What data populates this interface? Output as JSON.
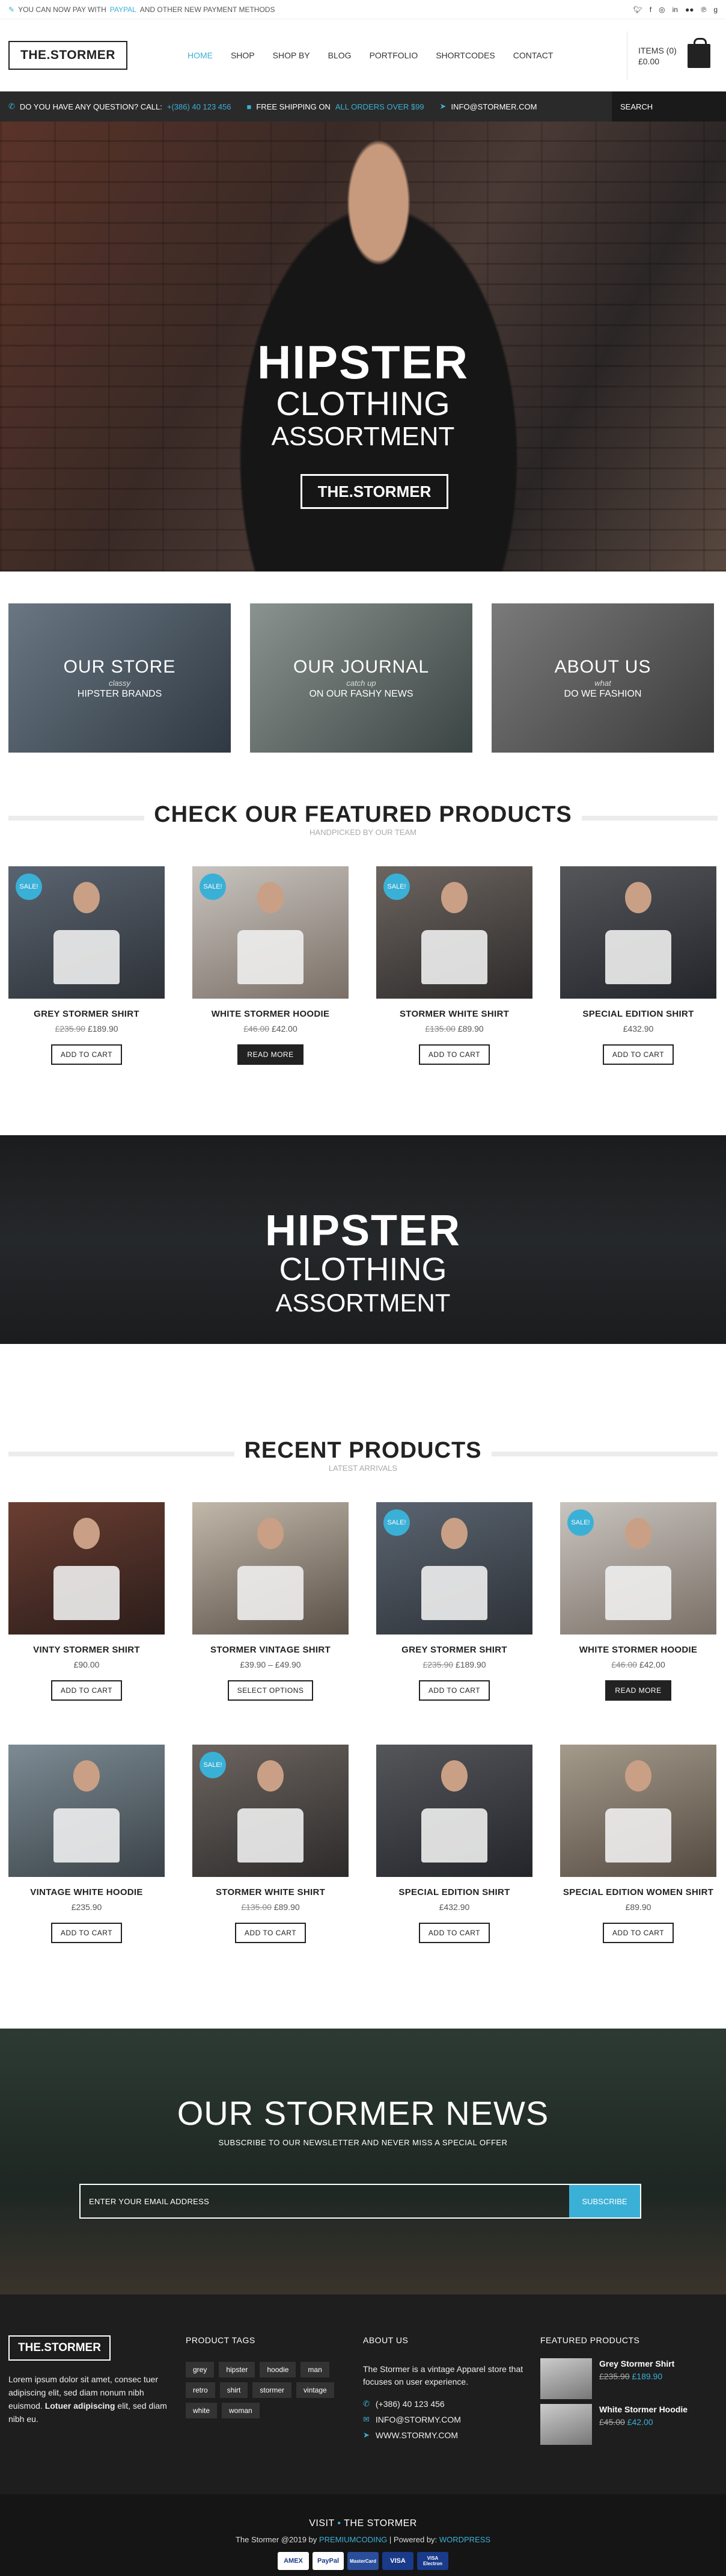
{
  "topbar": {
    "msg_prefix": "YOU CAN NOW PAY WITH",
    "msg_accent": "PAYPAL",
    "msg_suffix": "AND OTHER NEW PAYMENT METHODS",
    "socials": [
      "twitter-icon",
      "facebook-icon",
      "instagram-icon",
      "linkedin-icon",
      "flickr-icon",
      "pinterest-icon",
      "google-plus-icon"
    ]
  },
  "header": {
    "logo": "THE.STORMER",
    "nav": [
      "HOME",
      "SHOP",
      "SHOP BY",
      "BLOG",
      "PORTFOLIO",
      "SHORTCODES",
      "CONTACT"
    ],
    "cart_items": "ITEMS (0)",
    "cart_total": "£0.00"
  },
  "infobar": {
    "question": "DO YOU HAVE ANY QUESTION? CALL:",
    "phone": "+(386) 40 123 456",
    "ship_prefix": "FREE SHIPPING ON",
    "ship_accent": "ALL ORDERS OVER $99",
    "email": "INFO@STORMER.COM",
    "search": "SEARCH"
  },
  "hero": {
    "line1": "HIPSTER",
    "line2": "CLOTHING",
    "line3": "ASSORTMENT",
    "button": "THE.STORMER"
  },
  "categories": [
    {
      "title": "OUR STORE",
      "small": "classy",
      "sub": "HIPSTER BRANDS"
    },
    {
      "title": "OUR JOURNAL",
      "small": "catch up",
      "sub": "ON OUR FASHY NEWS"
    },
    {
      "title": "ABOUT US",
      "small": "what",
      "sub": "DO WE FASHION"
    }
  ],
  "featured": {
    "title": "CHECK OUR FEATURED PRODUCTS",
    "subtitle": "HANDPICKED BY OUR TEAM",
    "products": [
      {
        "name": "GREY STORMER SHIRT",
        "old": "£235.90",
        "price": "£189.90",
        "sale": "SALE!",
        "button": "ADD TO CART"
      },
      {
        "name": "WHITE STORMER HOODIE",
        "old": "£46.00",
        "price": "£42.00",
        "sale": "SALE!",
        "button": "READ MORE"
      },
      {
        "name": "STORMER WHITE SHIRT",
        "old": "£135.00",
        "price": "£89.90",
        "sale": "SALE!",
        "button": "ADD TO CART"
      },
      {
        "name": "SPECIAL EDITION SHIRT",
        "old": "",
        "price": "£432.90",
        "sale": "",
        "button": "ADD TO CART"
      }
    ]
  },
  "banner": {
    "line1": "HIPSTER",
    "line2": "CLOTHING",
    "line3": "ASSORTMENT"
  },
  "recent": {
    "title": "RECENT PRODUCTS",
    "subtitle": "LATEST ARRIVALS",
    "row1": [
      {
        "name": "VINTY STORMER SHIRT",
        "old": "",
        "price": "£90.00",
        "sale": "",
        "button": "ADD TO CART"
      },
      {
        "name": "STORMER VINTAGE SHIRT",
        "old": "",
        "price": "£39.90 – £49.90",
        "sale": "",
        "button": "SELECT OPTIONS"
      },
      {
        "name": "GREY STORMER SHIRT",
        "old": "£235.90",
        "price": "£189.90",
        "sale": "SALE!",
        "button": "ADD TO CART"
      },
      {
        "name": "WHITE STORMER HOODIE",
        "old": "£46.00",
        "price": "£42.00",
        "sale": "SALE!",
        "button": "READ MORE"
      }
    ],
    "row2": [
      {
        "name": "VINTAGE WHITE HOODIE",
        "old": "",
        "price": "£235.90",
        "sale": "",
        "button": "ADD TO CART"
      },
      {
        "name": "STORMER WHITE SHIRT",
        "old": "£135.00",
        "price": "£89.90",
        "sale": "SALE!",
        "button": "ADD TO CART"
      },
      {
        "name": "SPECIAL EDITION SHIRT",
        "old": "",
        "price": "£432.90",
        "sale": "",
        "button": "ADD TO CART"
      },
      {
        "name": "SPECIAL EDITION WOMEN SHIRT",
        "old": "",
        "price": "£89.90",
        "sale": "",
        "button": "ADD TO CART"
      }
    ]
  },
  "newsletter": {
    "title": "OUR STORMER NEWS",
    "subtitle": "SUBSCRIBE TO OUR NEWSLETTER AND NEVER MISS A SPECIAL OFFER",
    "placeholder": "ENTER YOUR EMAIL ADDRESS",
    "button": "SUBSCRIBE"
  },
  "footer": {
    "logo": "THE.STORMER",
    "text_a": "Lorem ipsum dolor sit amet, consec tuer adipiscing elit, sed diam nonum nibh euismod.",
    "text_b": "Lotuer adipiscing",
    "text_c": "elit, sed diam nibh eu.",
    "tags_title": "PRODUCT TAGS",
    "tags": [
      "grey",
      "hipster",
      "hoodie",
      "man",
      "retro",
      "shirt",
      "stormer",
      "vintage",
      "white",
      "woman"
    ],
    "about_title": "ABOUT US",
    "about_text": "The Stormer is a vintage Apparel store that focuses on user experience.",
    "phone": "(+386) 40 123 456",
    "email": "INFO@STORMY.COM",
    "web": "WWW.STORMY.COM",
    "fp_title": "FEATURED PRODUCTS",
    "fp": [
      {
        "name": "Grey Stormer Shirt",
        "old": "£235.90",
        "price": "£189.90"
      },
      {
        "name": "White Stormer Hoodie",
        "old": "£45.00",
        "price": "£42.00"
      }
    ]
  },
  "bottom": {
    "visit": "VISIT",
    "site": "THE STORMER",
    "copy_a": "The Stormer @2019 by",
    "copy_b": "PREMIUMCODING",
    "copy_c": "| Powered by:",
    "copy_d": "WORDPRESS",
    "pays": [
      "AMEX",
      "PayPal",
      "MasterCard",
      "VISA",
      "VISA Electron"
    ]
  },
  "colors": {
    "accent": "#3bb0d6",
    "dark": "#222222"
  }
}
